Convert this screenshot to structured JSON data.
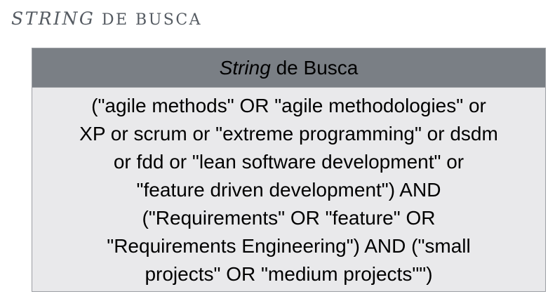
{
  "heading": {
    "italic": "String",
    "rest": " de busca"
  },
  "table": {
    "header_italic": "String",
    "header_rest": " de Busca",
    "query_lines": [
      "(\"agile methods\" OR \"agile methodologies\" or",
      "XP or scrum or \"extreme programming\" or dsdm",
      "or fdd or \"lean software development\" or",
      "\"feature driven development\") AND",
      "(\"Requirements\" OR \"feature\" OR",
      "\"Requirements Engineering\") AND (\"small",
      "projects\" OR \"medium projects\"\")"
    ]
  },
  "colors": {
    "header_bg": "#7a7f85",
    "body_bg": "#e9e9eb",
    "heading_text": "#555b62"
  }
}
